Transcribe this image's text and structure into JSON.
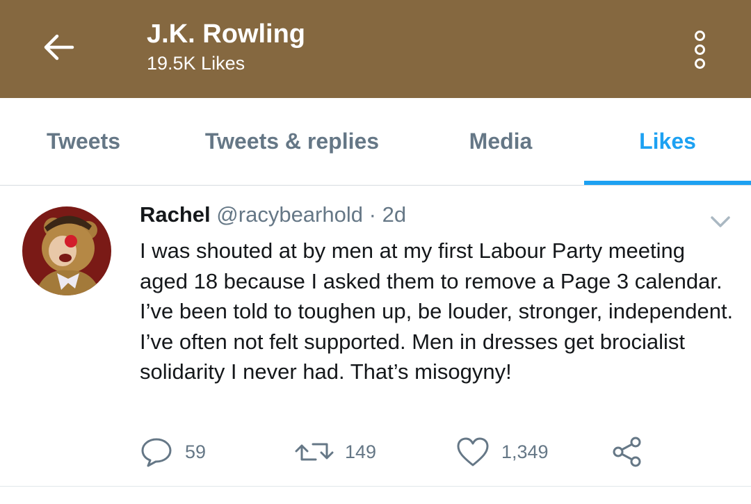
{
  "header": {
    "title": "J.K. Rowling",
    "subtitle": "19.5K Likes",
    "background_color": "#856840"
  },
  "tabs": [
    {
      "label": "Tweets",
      "active": false
    },
    {
      "label": "Tweets & replies",
      "active": false
    },
    {
      "label": "Media",
      "active": false
    },
    {
      "label": "Likes",
      "active": true
    }
  ],
  "accent_color": "#1da1f2",
  "tweet": {
    "name": "Rachel",
    "handle": "@racybearhold",
    "separator": "·",
    "time": "2d",
    "text": "I was shouted at by men at my first Labour Party meeting aged 18 because I asked them to remove a Page 3 calendar. I’ve been told to toughen up, be louder, stronger, independent. I’ve often not felt supported. Men in dresses get brocialist solidarity I never had. That’s misogyny!",
    "replies": "59",
    "retweets": "149",
    "likes": "1,349"
  },
  "icons": [
    "back-arrow-icon",
    "overflow-menu-icon",
    "chevron-down-icon",
    "reply-icon",
    "retweet-icon",
    "like-icon",
    "share-icon"
  ]
}
